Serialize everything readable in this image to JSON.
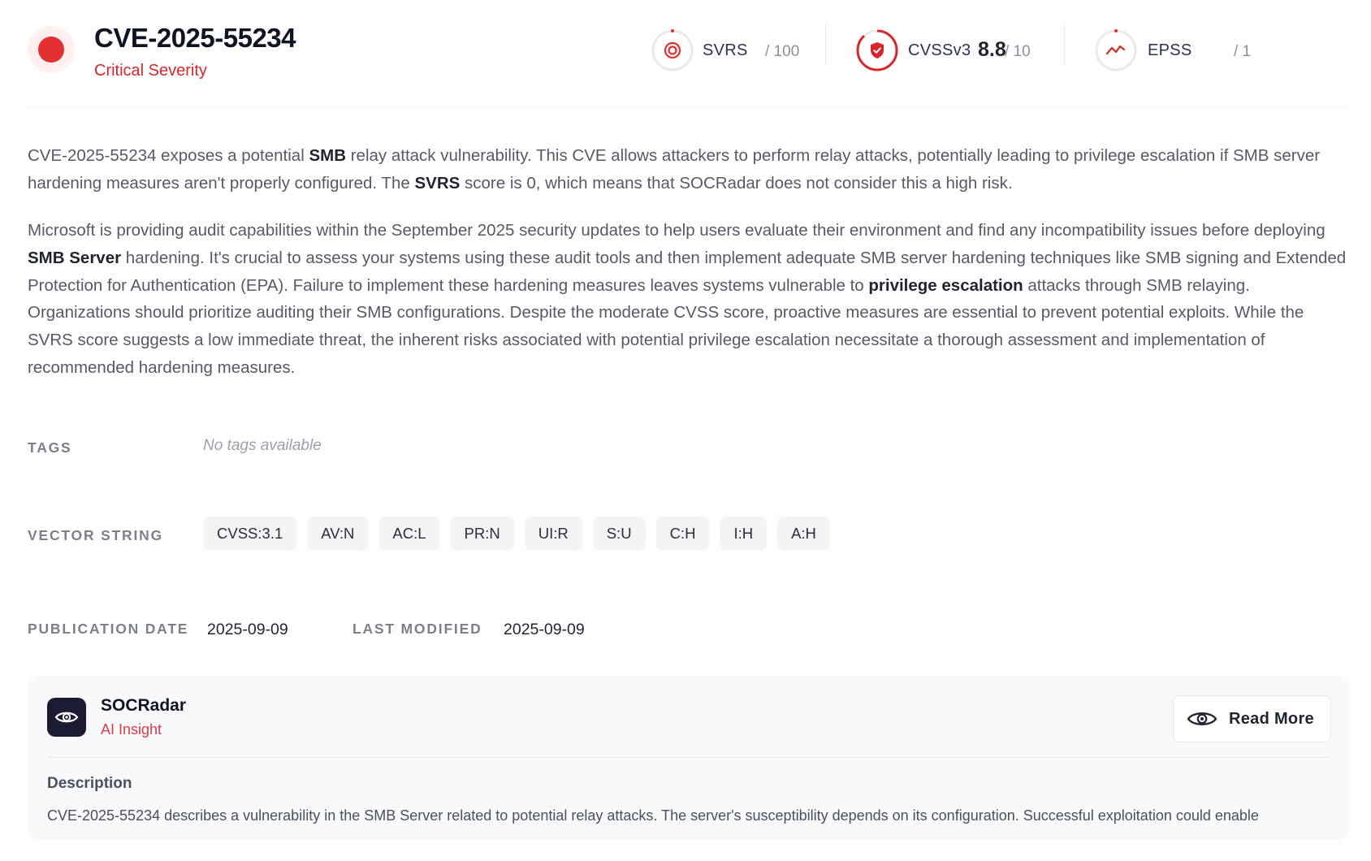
{
  "header": {
    "cve_id": "CVE-2025-55234",
    "severity_label": "Critical Severity",
    "severity_color": "#e1302f",
    "metrics": {
      "svrs": {
        "label": "SVRS",
        "max": "/ 100",
        "icon": "target-icon"
      },
      "cvss": {
        "label": "CVSSv3",
        "value": "8.8",
        "max": "/ 10",
        "icon": "shield-check-icon"
      },
      "epss": {
        "label": "EPSS",
        "max": "/ 1",
        "icon": "trend-line-icon"
      }
    }
  },
  "summary": {
    "p1": [
      {
        "t": "CVE-2025-55234 exposes a potential "
      },
      {
        "t": "SMB",
        "b": true
      },
      {
        "t": " relay attack vulnerability. This CVE allows attackers to perform relay attacks, potentially leading to privilege escalation if SMB server hardening measures aren't properly configured. The "
      },
      {
        "t": "SVRS",
        "b": true
      },
      {
        "t": " score is 0, which means that SOCRadar does not consider this a high risk."
      }
    ],
    "p2": [
      {
        "t": "Microsoft is providing audit capabilities within the September 2025 security updates to help users evaluate their environment and find any incompatibility issues before deploying "
      },
      {
        "t": "SMB Server",
        "b": true
      },
      {
        "t": " hardening. It's crucial to assess your systems using these audit tools and then implement adequate SMB server hardening techniques like SMB signing and Extended Protection for Authentication (EPA). Failure to implement these hardening measures leaves systems vulnerable to "
      },
      {
        "t": "privilege escalation",
        "b": true
      },
      {
        "t": " attacks through SMB relaying. Organizations should prioritize auditing their SMB configurations. Despite the moderate CVSS score, proactive measures are essential to prevent potential exploits. While the SVRS score suggests a low immediate threat, the inherent risks associated with potential privilege escalation necessitate a thorough assessment and implementation of recommended hardening measures."
      }
    ]
  },
  "tags": {
    "label": "TAGS",
    "empty_text": "No tags available"
  },
  "vector": {
    "label": "VECTOR STRING",
    "chips": [
      "CVSS:3.1",
      "AV:N",
      "AC:L",
      "PR:N",
      "UI:R",
      "S:U",
      "C:H",
      "I:H",
      "A:H"
    ]
  },
  "dates": {
    "publication_label": "PUBLICATION DATE",
    "publication_value": "2025-09-09",
    "modified_label": "LAST MODIFIED",
    "modified_value": "2025-09-09"
  },
  "insight": {
    "brand": "SOCRadar",
    "subtitle": "AI Insight",
    "read_more": "Read More",
    "description_heading": "Description",
    "description_text": "CVE-2025-55234 describes a vulnerability in the SMB Server related to potential relay attacks. The server's susceptibility depends on its configuration. Successful exploitation could enable"
  }
}
